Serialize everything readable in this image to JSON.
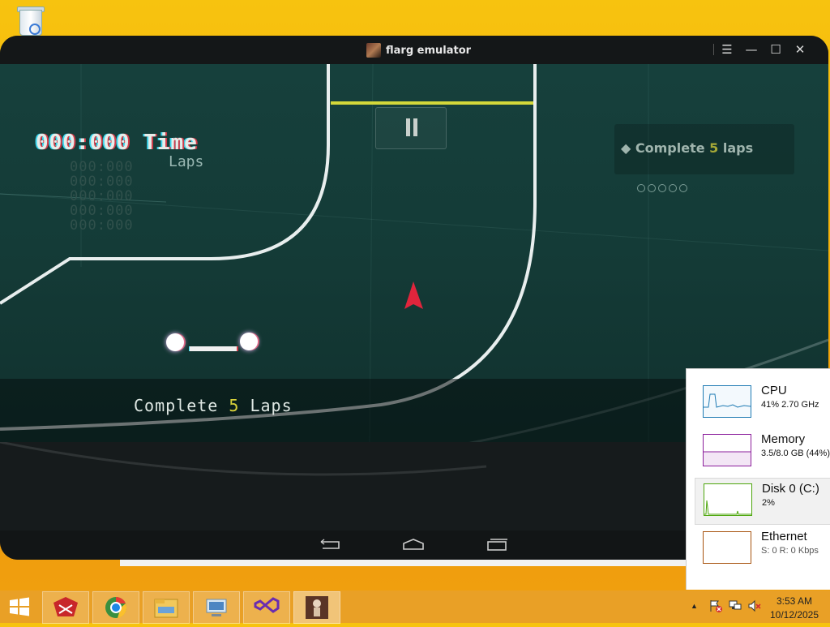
{
  "desktop": {
    "recycle_bin_icon": "recycle-bin-icon"
  },
  "window": {
    "title": "flarg emulator",
    "controls": {
      "menu": "☰",
      "minimize": "—",
      "maximize": "☐",
      "close": "✕"
    }
  },
  "game": {
    "time_display": "000:000 Time",
    "laps_label": "Laps",
    "lap_rows": [
      "000:000",
      "000:000",
      "000:000",
      "000:000",
      "000:000"
    ],
    "objective": {
      "prefix": "Complete",
      "number": "5",
      "suffix": "laps"
    },
    "banner": {
      "prefix": "Complete",
      "number": "5",
      "suffix": "Laps"
    },
    "pause_icon": "pause-icon"
  },
  "navbar": {
    "back": "back-icon",
    "home": "home-icon",
    "recents": "recents-icon"
  },
  "monitor": {
    "items": [
      {
        "name": "CPU",
        "value": "41% 2.70 GHz",
        "color": "#1e7ab3"
      },
      {
        "name": "Memory",
        "value": "3.5/8.0 GB (44%)",
        "color": "#8b1e9b"
      },
      {
        "name": "Disk 0 (C:)",
        "value": "2%",
        "color": "#4da60c"
      },
      {
        "name": "Ethernet",
        "value": "S: 0 R: 0 Kbps",
        "color": "#a7530e"
      }
    ]
  },
  "taskbar": {
    "apps": [
      "filezilla-icon",
      "chrome-icon",
      "file-explorer-icon",
      "remote-desktop-icon",
      "visual-studio-icon",
      "flarg-emulator-icon"
    ],
    "tray": {
      "chevron": "▲",
      "time": "3:53 AM",
      "date": "10/12/2025"
    }
  }
}
